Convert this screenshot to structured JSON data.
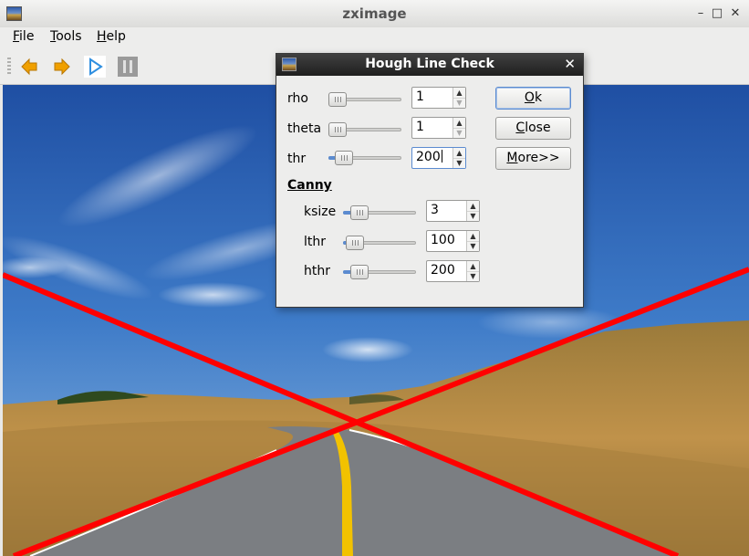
{
  "window": {
    "title": "zximage",
    "controls": [
      "–",
      "□",
      "✕"
    ]
  },
  "menu": [
    {
      "mnemonic": "F",
      "rest": "ile"
    },
    {
      "mnemonic": "T",
      "rest": "ools"
    },
    {
      "mnemonic": "H",
      "rest": "elp"
    }
  ],
  "toolbar": {
    "buttons": [
      {
        "name": "back-arrow-icon",
        "color": "#f0a000"
      },
      {
        "name": "forward-arrow-icon",
        "color": "#f0a000"
      },
      {
        "name": "play-icon",
        "color": "#2f8fe0"
      },
      {
        "name": "pause-icon",
        "color": "#9a9a9a"
      }
    ]
  },
  "dialog": {
    "title": "Hough Line Check",
    "close_glyph": "✕",
    "params": [
      {
        "label": "rho",
        "value": "1",
        "slider_fraction": 0.0,
        "up_enabled": true,
        "down_enabled": false
      },
      {
        "label": "theta",
        "value": "1",
        "slider_fraction": 0.0,
        "up_enabled": true,
        "down_enabled": false
      },
      {
        "label": "thr",
        "value": "200",
        "slider_fraction": 0.08,
        "up_enabled": true,
        "down_enabled": true,
        "focused": true
      }
    ],
    "canny_heading": "Canny",
    "canny_params": [
      {
        "label": "ksize",
        "value": "3",
        "slider_fraction": 0.05
      },
      {
        "label": "lthr",
        "value": "100",
        "slider_fraction": 0.02
      },
      {
        "label": "hthr",
        "value": "200",
        "slider_fraction": 0.05
      }
    ],
    "buttons": {
      "ok": {
        "mnemonic": "O",
        "rest": "k"
      },
      "close": {
        "mnemonic": "C",
        "rest": "lose"
      },
      "more": {
        "mnemonic": "M",
        "rest": "ore>>"
      }
    }
  },
  "image": {
    "description_colors": {
      "sky": "#2e63b8",
      "grass": "#b8893a",
      "road": "#7a7d80",
      "line_marking": "#f2c200",
      "detected_lines": "#ff0000"
    }
  }
}
